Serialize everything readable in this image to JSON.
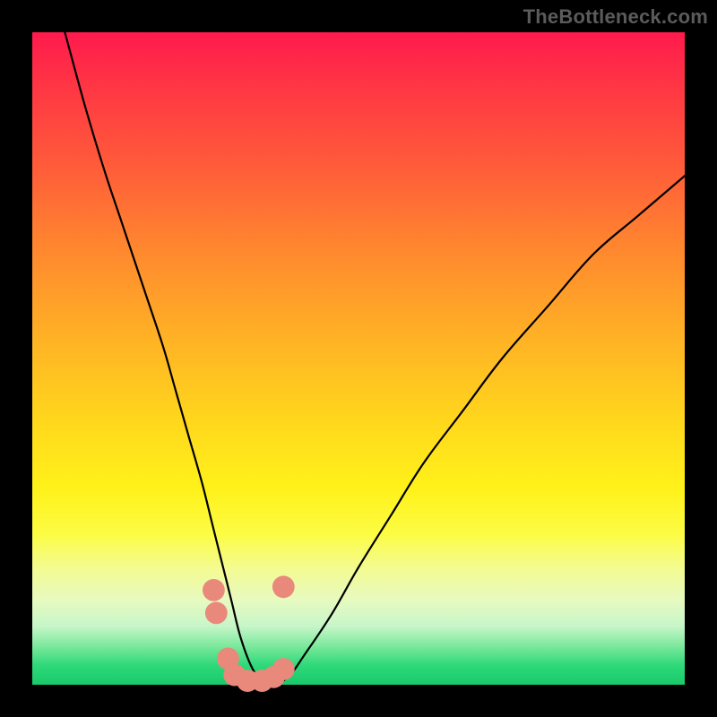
{
  "watermark": "TheBottleneck.com",
  "chart_data": {
    "type": "line",
    "title": "",
    "xlabel": "",
    "ylabel": "",
    "xlim": [
      0,
      100
    ],
    "ylim": [
      0,
      100
    ],
    "grid": false,
    "series": [
      {
        "name": "bottleneck-curve",
        "color": "#000000",
        "x": [
          5,
          8,
          11,
          14,
          17,
          20,
          22,
          24,
          26,
          27.5,
          29,
          30.5,
          32,
          34,
          36,
          39,
          42,
          46,
          50,
          55,
          60,
          66,
          72,
          79,
          86,
          93,
          100
        ],
        "y": [
          100,
          89,
          79,
          70,
          61,
          52,
          45,
          38,
          31,
          25,
          19,
          13,
          7,
          2,
          0,
          1,
          5,
          11,
          18,
          26,
          34,
          42,
          50,
          58,
          66,
          72,
          78
        ]
      }
    ],
    "markers": {
      "name": "highlight-points",
      "color": "#e8897c",
      "radius_pct": 1.7,
      "points": [
        {
          "x": 27.8,
          "y": 14.5
        },
        {
          "x": 28.2,
          "y": 11.0
        },
        {
          "x": 30.0,
          "y": 4.0
        },
        {
          "x": 31.0,
          "y": 1.5
        },
        {
          "x": 33.0,
          "y": 0.6
        },
        {
          "x": 35.2,
          "y": 0.6
        },
        {
          "x": 37.0,
          "y": 1.2
        },
        {
          "x": 38.5,
          "y": 2.4
        },
        {
          "x": 38.5,
          "y": 15.0
        }
      ]
    }
  }
}
